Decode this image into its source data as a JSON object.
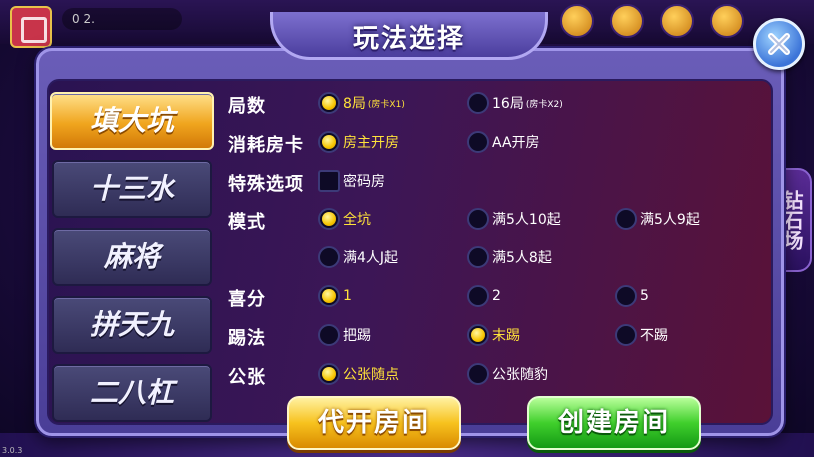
{
  "header": {
    "coins": "0 2.",
    "side_banner": "钻石场",
    "version": "3.0.3"
  },
  "dialog": {
    "title": "玩法选择",
    "close_icon": "close-x-icon"
  },
  "tabs": [
    {
      "label": "填大坑",
      "active": true
    },
    {
      "label": "十三水",
      "active": false
    },
    {
      "label": "麻将",
      "active": false
    },
    {
      "label": "拼天九",
      "active": false
    },
    {
      "label": "二八杠",
      "active": false
    }
  ],
  "rows": {
    "rounds": {
      "label": "局数",
      "options": [
        {
          "label": "8局",
          "sub": "(房卡X1)",
          "selected": true
        },
        {
          "label": "16局",
          "sub": "(房卡X2)",
          "selected": false
        }
      ]
    },
    "card_cost": {
      "label": "消耗房卡",
      "options": [
        {
          "label": "房主开房",
          "selected": true
        },
        {
          "label": "AA开房",
          "selected": false
        }
      ]
    },
    "special": {
      "label": "特殊选项",
      "options": [
        {
          "label": "密码房",
          "checked": false
        }
      ]
    },
    "mode": {
      "label": "模式",
      "options": [
        {
          "label": "全坑",
          "selected": true
        },
        {
          "label": "满5人10起",
          "selected": false
        },
        {
          "label": "满5人9起",
          "selected": false
        },
        {
          "label": "满4人J起",
          "selected": false
        },
        {
          "label": "满5人8起",
          "selected": false
        }
      ]
    },
    "bonus": {
      "label": "喜分",
      "options": [
        {
          "label": "1",
          "selected": true
        },
        {
          "label": "2",
          "selected": false
        },
        {
          "label": "5",
          "selected": false
        }
      ]
    },
    "kick": {
      "label": "踢法",
      "options": [
        {
          "label": "把踢",
          "selected": false
        },
        {
          "label": "末踢",
          "selected": true
        },
        {
          "label": "不踢",
          "selected": false
        }
      ]
    },
    "public_card": {
      "label": "公张",
      "options": [
        {
          "label": "公张随点",
          "selected": true
        },
        {
          "label": "公张随豹",
          "selected": false
        }
      ]
    }
  },
  "buttons": {
    "proxy_open": "代开房间",
    "create_room": "创建房间"
  }
}
